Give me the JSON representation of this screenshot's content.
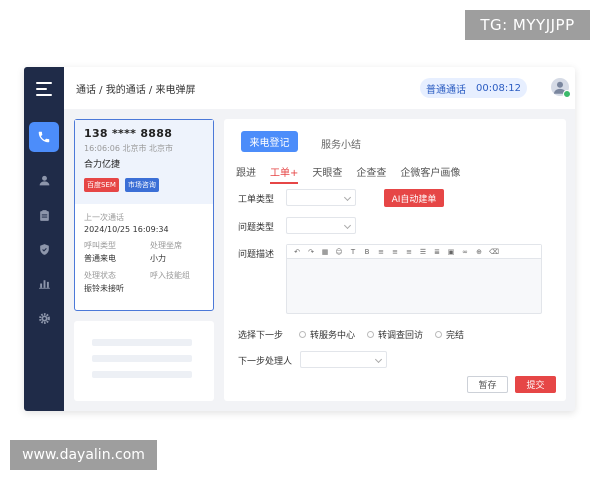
{
  "watermarks": {
    "top": "TG: MYYJJPP",
    "bottom": "www.dayalin.com"
  },
  "header": {
    "breadcrumb": "通话 / 我的通话 / 来电弹屏",
    "call_type": "普通通话",
    "call_timer": "00:08:12"
  },
  "sidebar": {
    "items": [
      "phone-icon",
      "user-icon",
      "clipboard-icon",
      "shield-icon",
      "chart-icon",
      "gear-icon"
    ],
    "active": "phone-icon"
  },
  "caller": {
    "phone": "138 **** 8888",
    "time_location": "16:06:06 北京市 北京市",
    "company": "合力亿捷",
    "tags": [
      "百度SEM",
      "市场咨询"
    ],
    "last_call_label": "上一次通话",
    "last_call_value": "2024/10/25  16:09:34",
    "call_type_label": "呼叫类型",
    "call_type_value": "普通来电",
    "agent_label": "处理坐席",
    "agent_value": "小力",
    "status_label": "处理状态",
    "status_value": "振铃未接听",
    "skill_label": "呼入技能组",
    "skill_value": ""
  },
  "main": {
    "primary_tab": "来电登记",
    "secondary_tab": "服务小结",
    "subtabs": [
      "跟进",
      "工单+",
      "天眼查",
      "企查查",
      "企微客户画像"
    ],
    "active_subtab": "工单+",
    "ticket_type_label": "工单类型",
    "issue_type_label": "问题类型",
    "ai_button": "AI自动建单",
    "issue_desc_label": "问题描述",
    "next_step_label": "选择下一步",
    "next_options": [
      "转服务中心",
      "转调查回访",
      "完结"
    ],
    "next_handler_label": "下一步处理人",
    "save_button": "暂存",
    "submit_button": "提交"
  },
  "colors": {
    "sidebar": "#1f2b48",
    "accent": "#4c8dfa",
    "danger": "#e64646"
  }
}
